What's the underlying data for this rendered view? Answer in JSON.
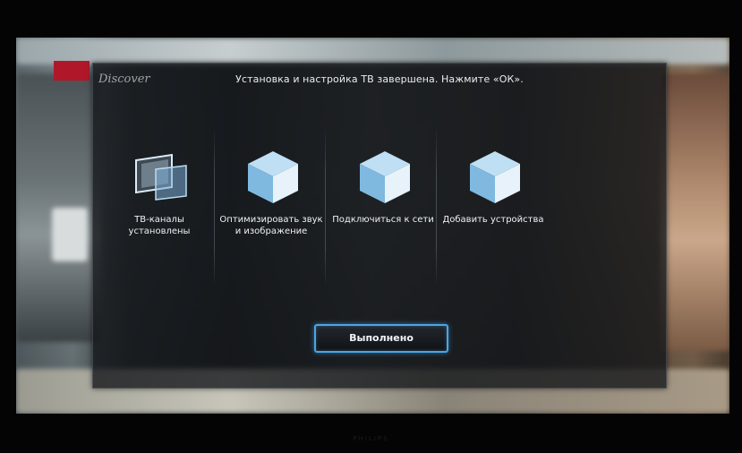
{
  "dialog": {
    "logo_text": "Discover",
    "title": "Установка и настройка ТВ завершена. Нажмите «ОК».",
    "options": [
      {
        "label": "ТВ-каналы установлены",
        "icon": "tv-screens-icon"
      },
      {
        "label": "Оптимизировать звук и изображение",
        "icon": "cube-icon"
      },
      {
        "label": "Подключиться к сети",
        "icon": "cube-icon"
      },
      {
        "label": "Добавить устройства",
        "icon": "cube-icon"
      }
    ],
    "done_button": "Выполнено"
  },
  "colors": {
    "accent": "#4aa6e6",
    "cube_top": "#bfe0f4",
    "cube_left": "#7fb9df",
    "cube_right": "#e7f2fa",
    "brand_red": "#b0182a"
  },
  "bezel": {
    "brand": "PHILIPS"
  }
}
